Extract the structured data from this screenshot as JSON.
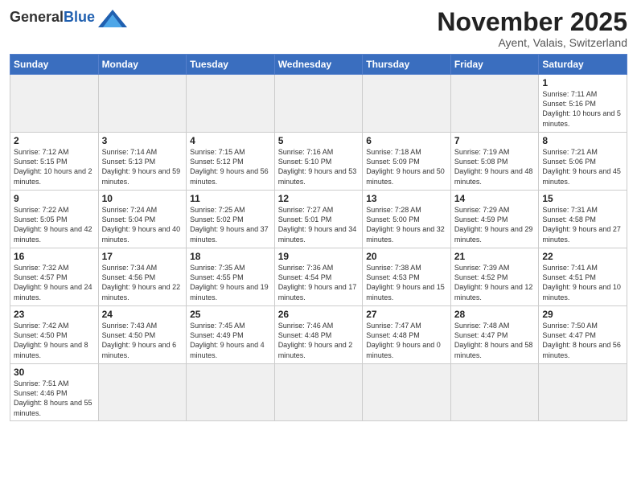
{
  "logo": {
    "general": "General",
    "blue": "Blue"
  },
  "header": {
    "month": "November 2025",
    "location": "Ayent, Valais, Switzerland"
  },
  "weekdays": [
    "Sunday",
    "Monday",
    "Tuesday",
    "Wednesday",
    "Thursday",
    "Friday",
    "Saturday"
  ],
  "weeks": [
    [
      {
        "day": "",
        "info": ""
      },
      {
        "day": "",
        "info": ""
      },
      {
        "day": "",
        "info": ""
      },
      {
        "day": "",
        "info": ""
      },
      {
        "day": "",
        "info": ""
      },
      {
        "day": "",
        "info": ""
      },
      {
        "day": "1",
        "info": "Sunrise: 7:11 AM\nSunset: 5:16 PM\nDaylight: 10 hours and 5 minutes."
      }
    ],
    [
      {
        "day": "2",
        "info": "Sunrise: 7:12 AM\nSunset: 5:15 PM\nDaylight: 10 hours and 2 minutes."
      },
      {
        "day": "3",
        "info": "Sunrise: 7:14 AM\nSunset: 5:13 PM\nDaylight: 9 hours and 59 minutes."
      },
      {
        "day": "4",
        "info": "Sunrise: 7:15 AM\nSunset: 5:12 PM\nDaylight: 9 hours and 56 minutes."
      },
      {
        "day": "5",
        "info": "Sunrise: 7:16 AM\nSunset: 5:10 PM\nDaylight: 9 hours and 53 minutes."
      },
      {
        "day": "6",
        "info": "Sunrise: 7:18 AM\nSunset: 5:09 PM\nDaylight: 9 hours and 50 minutes."
      },
      {
        "day": "7",
        "info": "Sunrise: 7:19 AM\nSunset: 5:08 PM\nDaylight: 9 hours and 48 minutes."
      },
      {
        "day": "8",
        "info": "Sunrise: 7:21 AM\nSunset: 5:06 PM\nDaylight: 9 hours and 45 minutes."
      }
    ],
    [
      {
        "day": "9",
        "info": "Sunrise: 7:22 AM\nSunset: 5:05 PM\nDaylight: 9 hours and 42 minutes."
      },
      {
        "day": "10",
        "info": "Sunrise: 7:24 AM\nSunset: 5:04 PM\nDaylight: 9 hours and 40 minutes."
      },
      {
        "day": "11",
        "info": "Sunrise: 7:25 AM\nSunset: 5:02 PM\nDaylight: 9 hours and 37 minutes."
      },
      {
        "day": "12",
        "info": "Sunrise: 7:27 AM\nSunset: 5:01 PM\nDaylight: 9 hours and 34 minutes."
      },
      {
        "day": "13",
        "info": "Sunrise: 7:28 AM\nSunset: 5:00 PM\nDaylight: 9 hours and 32 minutes."
      },
      {
        "day": "14",
        "info": "Sunrise: 7:29 AM\nSunset: 4:59 PM\nDaylight: 9 hours and 29 minutes."
      },
      {
        "day": "15",
        "info": "Sunrise: 7:31 AM\nSunset: 4:58 PM\nDaylight: 9 hours and 27 minutes."
      }
    ],
    [
      {
        "day": "16",
        "info": "Sunrise: 7:32 AM\nSunset: 4:57 PM\nDaylight: 9 hours and 24 minutes."
      },
      {
        "day": "17",
        "info": "Sunrise: 7:34 AM\nSunset: 4:56 PM\nDaylight: 9 hours and 22 minutes."
      },
      {
        "day": "18",
        "info": "Sunrise: 7:35 AM\nSunset: 4:55 PM\nDaylight: 9 hours and 19 minutes."
      },
      {
        "day": "19",
        "info": "Sunrise: 7:36 AM\nSunset: 4:54 PM\nDaylight: 9 hours and 17 minutes."
      },
      {
        "day": "20",
        "info": "Sunrise: 7:38 AM\nSunset: 4:53 PM\nDaylight: 9 hours and 15 minutes."
      },
      {
        "day": "21",
        "info": "Sunrise: 7:39 AM\nSunset: 4:52 PM\nDaylight: 9 hours and 12 minutes."
      },
      {
        "day": "22",
        "info": "Sunrise: 7:41 AM\nSunset: 4:51 PM\nDaylight: 9 hours and 10 minutes."
      }
    ],
    [
      {
        "day": "23",
        "info": "Sunrise: 7:42 AM\nSunset: 4:50 PM\nDaylight: 9 hours and 8 minutes."
      },
      {
        "day": "24",
        "info": "Sunrise: 7:43 AM\nSunset: 4:50 PM\nDaylight: 9 hours and 6 minutes."
      },
      {
        "day": "25",
        "info": "Sunrise: 7:45 AM\nSunset: 4:49 PM\nDaylight: 9 hours and 4 minutes."
      },
      {
        "day": "26",
        "info": "Sunrise: 7:46 AM\nSunset: 4:48 PM\nDaylight: 9 hours and 2 minutes."
      },
      {
        "day": "27",
        "info": "Sunrise: 7:47 AM\nSunset: 4:48 PM\nDaylight: 9 hours and 0 minutes."
      },
      {
        "day": "28",
        "info": "Sunrise: 7:48 AM\nSunset: 4:47 PM\nDaylight: 8 hours and 58 minutes."
      },
      {
        "day": "29",
        "info": "Sunrise: 7:50 AM\nSunset: 4:47 PM\nDaylight: 8 hours and 56 minutes."
      }
    ],
    [
      {
        "day": "30",
        "info": "Sunrise: 7:51 AM\nSunset: 4:46 PM\nDaylight: 8 hours and 55 minutes."
      },
      {
        "day": "",
        "info": ""
      },
      {
        "day": "",
        "info": ""
      },
      {
        "day": "",
        "info": ""
      },
      {
        "day": "",
        "info": ""
      },
      {
        "day": "",
        "info": ""
      },
      {
        "day": "",
        "info": ""
      }
    ]
  ]
}
